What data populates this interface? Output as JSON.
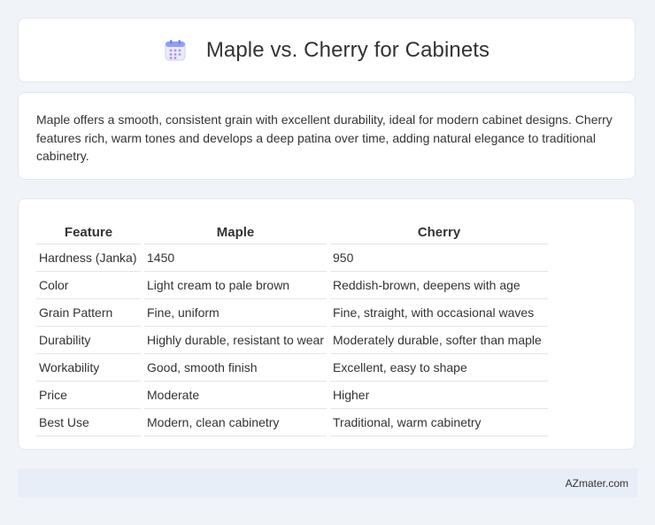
{
  "header": {
    "title": "Maple vs. Cherry for Cabinets",
    "icon": "calendar-icon",
    "icon_color": "#7b8ff0"
  },
  "description": "Maple offers a smooth, consistent grain with excellent durability, ideal for modern cabinet designs. Cherry features rich, warm tones and develops a deep patina over time, adding natural elegance to traditional cabinetry.",
  "table": {
    "headers": [
      "Feature",
      "Maple",
      "Cherry"
    ],
    "rows": [
      [
        "Hardness (Janka)",
        "1450",
        "950"
      ],
      [
        "Color",
        "Light cream to pale brown",
        "Reddish-brown, deepens with age"
      ],
      [
        "Grain Pattern",
        "Fine, uniform",
        "Fine, straight, with occasional waves"
      ],
      [
        "Durability",
        "Highly durable, resistant to wear",
        "Moderately durable, softer than maple"
      ],
      [
        "Workability",
        "Good, smooth finish",
        "Excellent, easy to shape"
      ],
      [
        "Price",
        "Moderate",
        "Higher"
      ],
      [
        "Best Use",
        "Modern, clean cabinetry",
        "Traditional, warm cabinetry"
      ]
    ]
  },
  "footer": {
    "site": "AZmater.com"
  }
}
